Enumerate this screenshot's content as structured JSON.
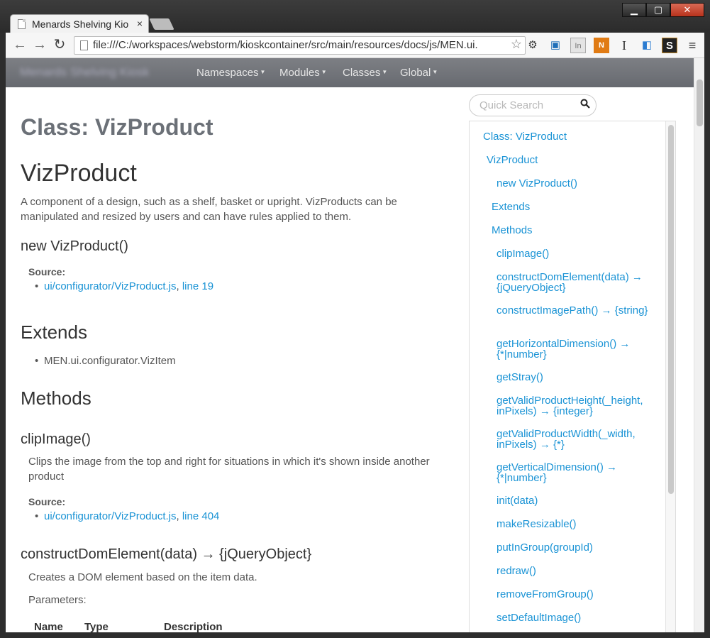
{
  "browser": {
    "tab_title": "Menards Shelving Kio",
    "tab_close": "×",
    "url": "file:///C:/workspaces/webstorm/kioskcontainer/src/main/resources/docs/js/MEN.ui.",
    "back": "←",
    "forward": "→",
    "reload": "↻",
    "star": "☆",
    "minimize": "▁",
    "maximize": "▢",
    "close": "✕",
    "extensions": [
      "gear-icon",
      "monitor-icon",
      "in-icon",
      "new-icon",
      "cursor-icon",
      "tab-icon",
      "s-icon",
      "menu-icon"
    ],
    "ext_glyphs": [
      "⚙",
      "▣",
      "In",
      "N",
      "I",
      "◧",
      "S",
      "≡"
    ]
  },
  "navbar": {
    "brand": "Menards Shelving Kiosk",
    "items": [
      "Namespaces",
      "Modules",
      "Classes",
      "Global"
    ]
  },
  "main": {
    "page_title": "Class: VizProduct",
    "class_name": "VizProduct",
    "description": "A component of a design, such as a shelf, basket or upright. VizProducts can be manipulated and resized by users and can have rules applied to them.",
    "constructor_sig": "new VizProduct()",
    "source_label": "Source:",
    "ctor_source_file": "ui/configurator/VizProduct.js",
    "ctor_source_line": "line 19",
    "extends_heading": "Extends",
    "extends_item": "MEN.ui.configurator.VizItem",
    "methods_heading": "Methods",
    "m1_sig": "clipImage()",
    "m1_desc": "Clips the image from the top and right for situations in which it's shown inside another product",
    "m1_source_file": "ui/configurator/VizProduct.js",
    "m1_source_line": "line 404",
    "m2_sig": "constructDomElement(data) → {jQueryObject}",
    "m2_desc": "Creates a DOM element based on the item data.",
    "params_label": "Parameters:",
    "table_headers": [
      "Name",
      "Type",
      "Description"
    ],
    "comma": ","
  },
  "sidebar": {
    "search_placeholder": "Quick Search",
    "toc": [
      "Class: VizProduct",
      "VizProduct",
      "new VizProduct()",
      "Extends",
      "Methods",
      "clipImage()",
      "constructDomElement(data) → {jQueryObject}",
      "constructImagePath() → {string}",
      "getHorizontalDimension() → {*|number}",
      "getStray()",
      "getValidProductHeight(_height, inPixels) → {integer}",
      "getValidProductWidth(_width, inPixels) → {*}",
      "getVerticalDimension() → {*|number}",
      "init(data)",
      "makeResizable()",
      "putInGroup(groupId)",
      "redraw()",
      "removeFromGroup()",
      "setDefaultImage()"
    ]
  }
}
